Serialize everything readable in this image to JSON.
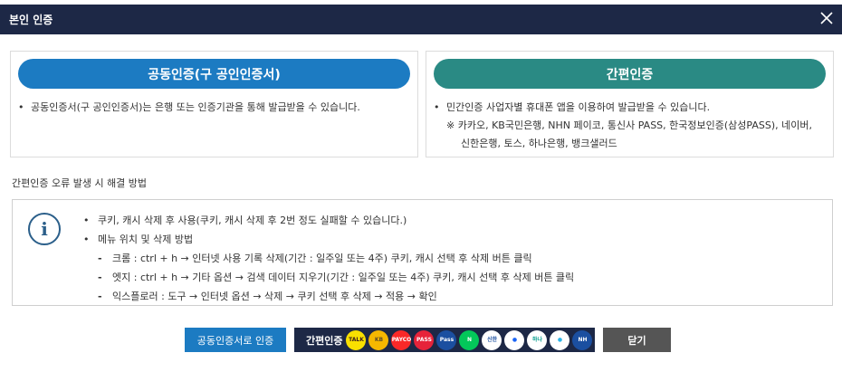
{
  "dialog": {
    "title": "본인 인증"
  },
  "left_panel": {
    "button_label": "공동인증(구 공인인증서)",
    "desc": "공동인증서(구 공인인증서)는 은행 또는 인증기관을 통해 발급받을 수 있습니다."
  },
  "right_panel": {
    "button_label": "간편인증",
    "desc_line1": "민간인증 사업자별 휴대폰 앱을 이용하여 발급받을 수 있습니다.",
    "desc_line2": "※ 카카오, KB국민은행, NHN 페이코, 통신사 PASS, 한국정보인증(삼성PASS), 네이버,",
    "desc_line3": "신한은행, 토스, 하나은행, 뱅크샐러드"
  },
  "help": {
    "title": "간편인증 오류 발생 시 해결 방법",
    "line1": "쿠키, 캐시 삭제 후 사용(쿠키, 캐시 삭제 후 2번 정도 실패할 수 있습니다.)",
    "line2": "메뉴 위치 및 삭제 방법",
    "line3": "크롬 : ctrl + h → 인터넷 사용 기록 삭제(기간 : 일주일 또는 4주) 쿠키, 캐시 선택 후 삭제 버튼 클릭",
    "line4": "엣지 : ctrl + h → 기타 옵션 → 검색 데이터 지우기(기간 : 일주일 또는 4주) 쿠키, 캐시 선택 후 삭제 버튼 클릭",
    "line5": "익스플로러 : 도구 → 인터넷 옵션 → 삭제 → 쿠키 선택 후 삭제 → 적용 → 확인"
  },
  "footer": {
    "cert_button": "공동인증서로 인증",
    "simple_button": "간편인증",
    "close_button": "닫기",
    "logos": [
      {
        "text": "TALK",
        "bg": "#f9e000",
        "fg": "#3c1e1e"
      },
      {
        "text": "KB",
        "bg": "#f5b700",
        "fg": "#5a4a2a"
      },
      {
        "text": "PAYCO",
        "bg": "#fa2828",
        "fg": "#ffffff"
      },
      {
        "text": "PASS",
        "bg": "#e6233a",
        "fg": "#ffffff"
      },
      {
        "text": "Pass",
        "bg": "#1b4fa0",
        "fg": "#ffffff"
      },
      {
        "text": "N",
        "bg": "#03c75a",
        "fg": "#ffffff"
      },
      {
        "text": "신한",
        "bg": "#ffffff",
        "fg": "#1b4fa0"
      },
      {
        "text": "●",
        "bg": "#ffffff",
        "fg": "#1a64f5"
      },
      {
        "text": "하나",
        "bg": "#ffffff",
        "fg": "#009b8b"
      },
      {
        "text": "●",
        "bg": "#ffffff",
        "fg": "#2bb3e6"
      },
      {
        "text": "NH",
        "bg": "#1b4fa0",
        "fg": "#ffffff"
      }
    ]
  }
}
